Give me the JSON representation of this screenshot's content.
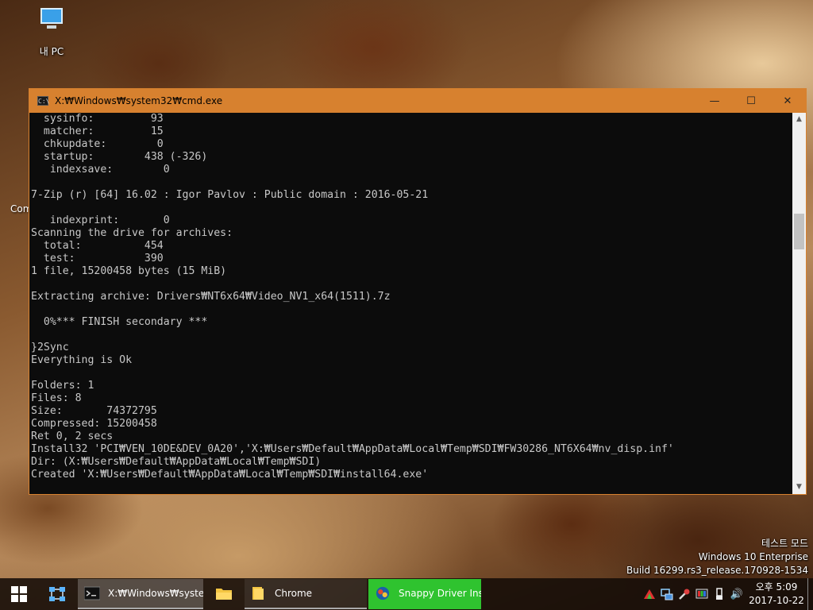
{
  "desktop": {
    "icon_label": "내 PC",
    "side_label": "Com"
  },
  "window": {
    "title": "X:₩Windows₩system32₩cmd.exe",
    "minimize_glyph": "—",
    "maximize_glyph": "☐",
    "close_glyph": "✕",
    "accent_color": "#d7812f"
  },
  "console": {
    "lines": [
      "  sysinfo:         93",
      "  matcher:         15",
      "  chkupdate:        0",
      "  startup:        438 (-326)",
      "   indexsave:        0",
      "",
      "7-Zip (r) [64] 16.02 : Igor Pavlov : Public domain : 2016-05-21",
      "",
      "   indexprint:       0",
      "Scanning the drive for archives:",
      "  total:          454",
      "  test:           390",
      "1 file, 15200458 bytes (15 MiB)",
      "",
      "Extracting archive: Drivers₩NT6x64₩Video_NV1_x64(1511).7z",
      "",
      "  0%*** FINISH secondary ***",
      "",
      "}2Sync",
      "Everything is Ok",
      "",
      "Folders: 1",
      "Files: 8",
      "Size:       74372795",
      "Compressed: 15200458",
      "Ret 0, 2 secs",
      "Install32 'PCI₩VEN_10DE&DEV_0A20','X:₩Users₩Default₩AppData₩Local₩Temp₩SDI₩FW30286_NT6X64₩nv_disp.inf'",
      "Dir: (X:₩Users₩Default₩AppData₩Local₩Temp₩SDI)",
      "Created 'X:₩Users₩Default₩AppData₩Local₩Temp₩SDI₩install64.exe'",
      ""
    ]
  },
  "watermark": {
    "line1": "테스트 모드",
    "line2": "Windows 10 Enterprise",
    "line3": "Build 16299.rs3_release.170928-1534"
  },
  "taskbar": {
    "cmd_label": "X:₩Windows₩syste...",
    "chrome_label": "Chrome",
    "sdi_label": "Snappy Driver Inst...",
    "sdi_color": "#2fc32f",
    "clock_time": "오후 5:09",
    "clock_date": "2017-10-22",
    "volume_icon": "🔊"
  }
}
